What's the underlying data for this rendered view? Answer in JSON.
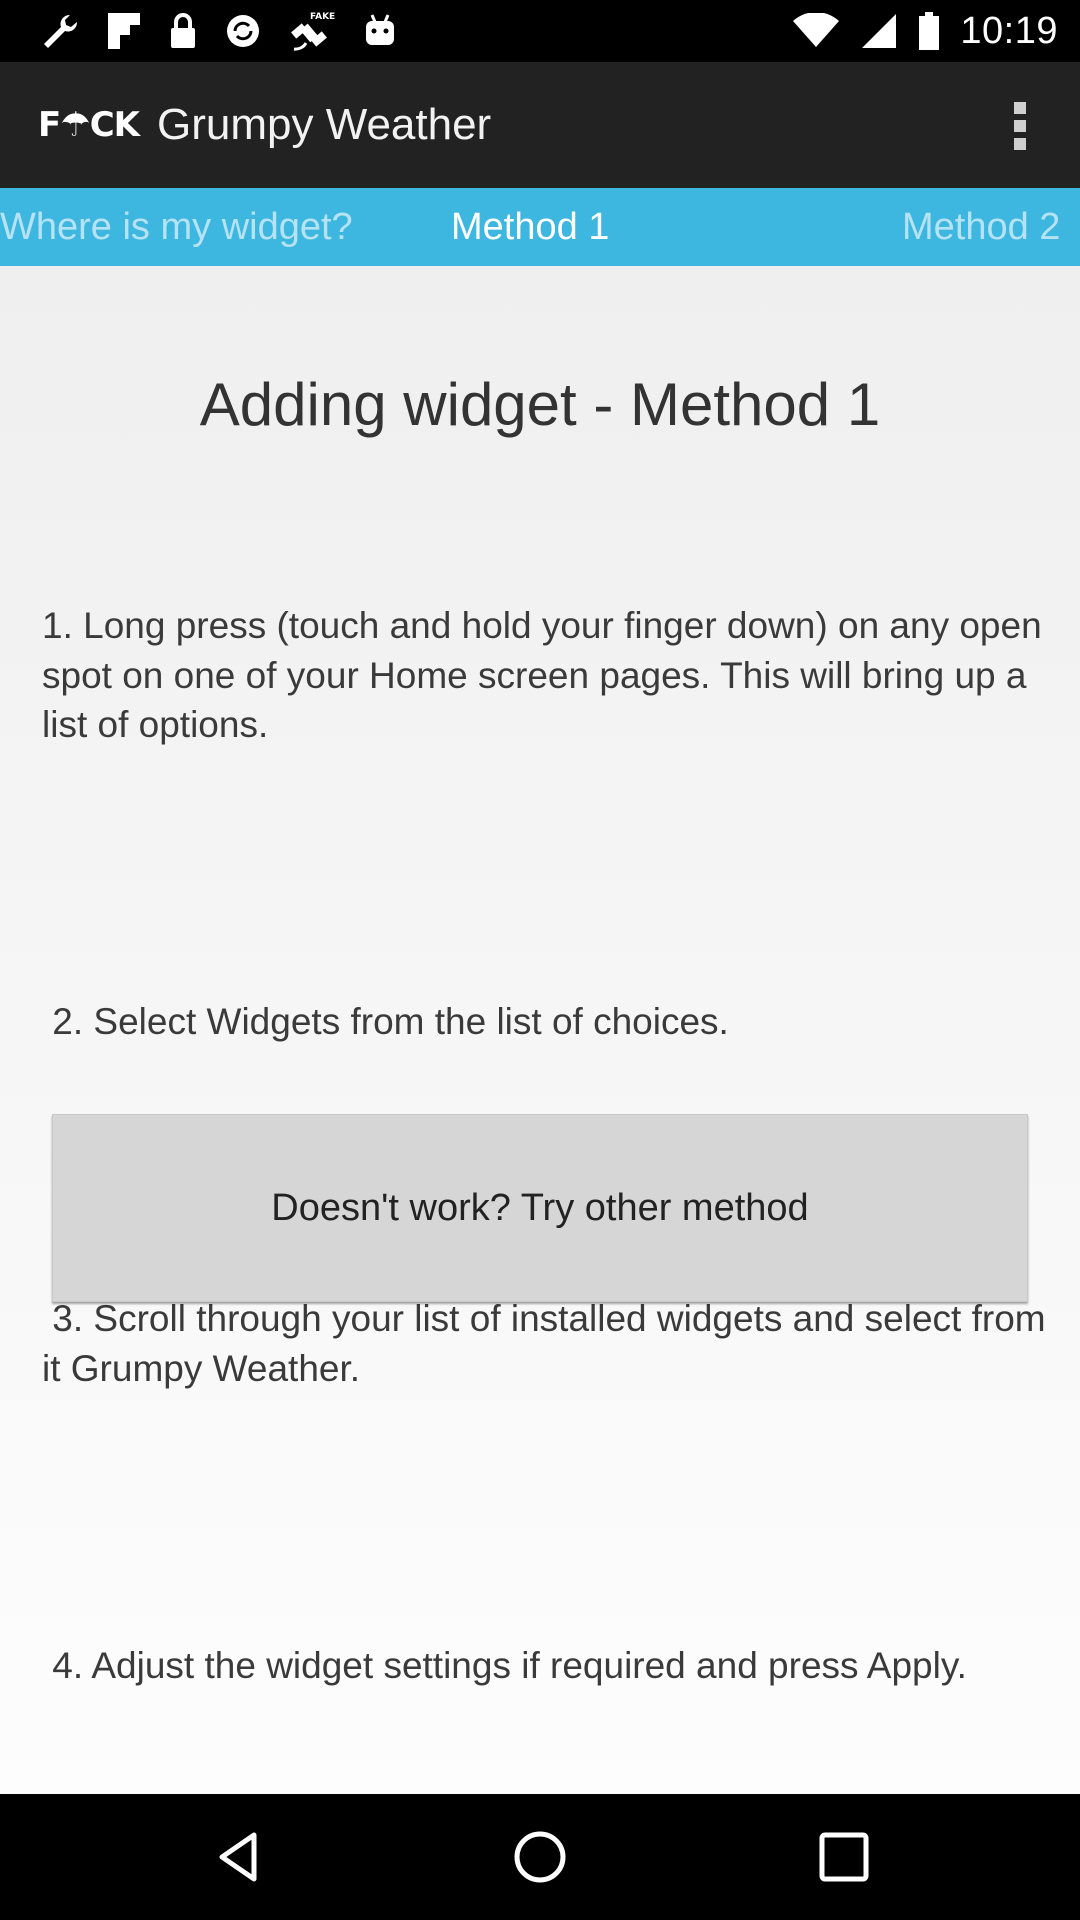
{
  "status_bar": {
    "time": "10:19",
    "icons": [
      "wrench-icon",
      "flipboard-icon",
      "lock-icon",
      "sync-icon",
      "fake-gps-icon",
      "android-icon",
      "wifi-icon",
      "signal-icon",
      "battery-icon"
    ]
  },
  "app_bar": {
    "logo": "F☂CK",
    "title": "Grumpy Weather",
    "overflow_icon": "more-vert-icon"
  },
  "tabs": [
    {
      "label": "Where is my widget?",
      "selected": false
    },
    {
      "label": "Method 1",
      "selected": true
    },
    {
      "label": "Method 2",
      "selected": false
    }
  ],
  "colors": {
    "tab_bar": "#3db6e0",
    "app_bar": "#222222",
    "button": "#d6d6d6"
  },
  "main": {
    "heading": "Adding widget - Method 1",
    "steps": [
      "1. Long press (touch and hold your finger down) on any open spot on one of your Home screen pages. This will bring up a list of options.",
      " 2. Select Widgets from the list of choices.",
      " 3. Scroll through your list of installed widgets and select from it Grumpy Weather.",
      " 4. Adjust the widget settings if required and press Apply."
    ],
    "button_label": "Doesn't work? Try other method"
  },
  "nav_bar": {
    "icons": [
      "back-icon",
      "home-icon",
      "recent-apps-icon"
    ]
  }
}
